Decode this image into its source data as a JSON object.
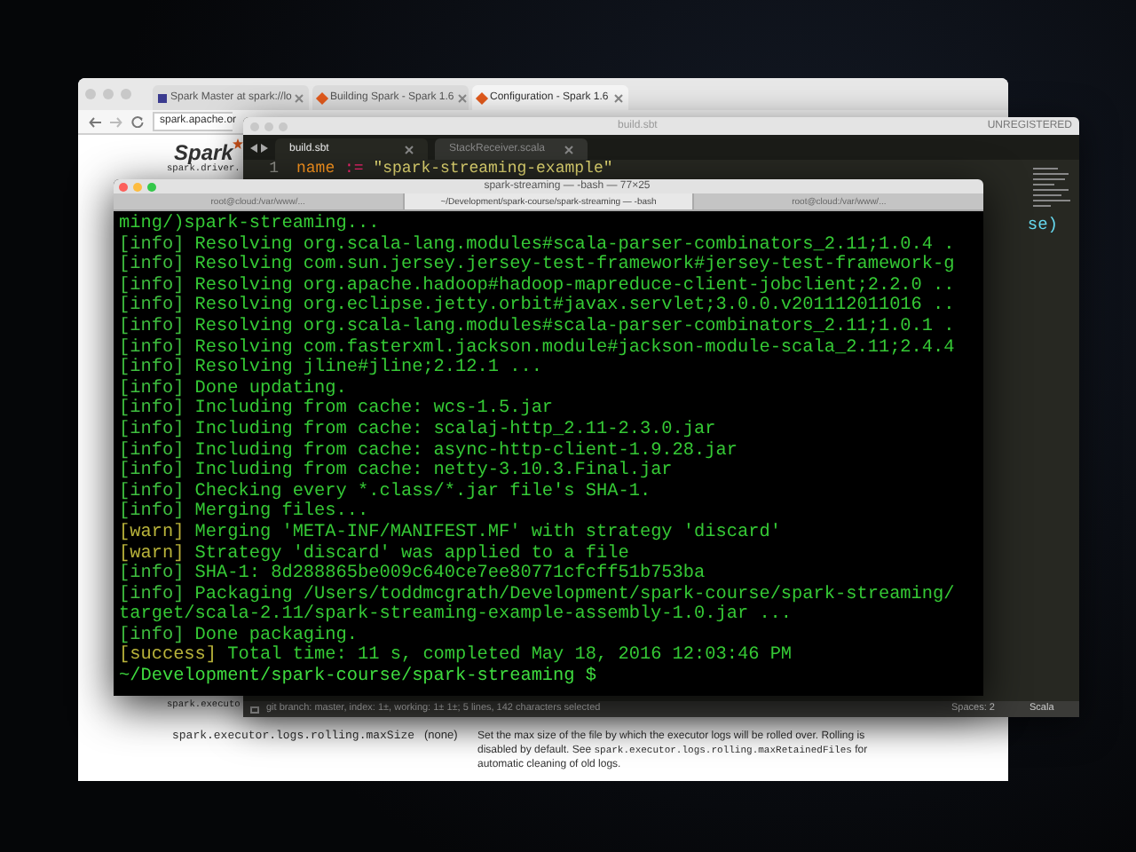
{
  "browser": {
    "tabs": [
      {
        "label": "Spark Master at spark://lo",
        "selected": false
      },
      {
        "label": "Building Spark - Spark 1.6",
        "selected": false
      },
      {
        "label": "Configuration - Spark 1.6",
        "selected": true
      }
    ],
    "url": "spark.apache.or",
    "logo_text": "Spark",
    "peek_texts": [
      "spark.driver.",
      "spark.executo"
    ],
    "config_row": {
      "name": "spark.executor.logs.rolling.maxSize",
      "default": "(none)",
      "description": [
        {
          "text": "Set the max size of the file by which the executor logs will be rolled over. Rolling is disabled by default. See ",
          "kind": "prose"
        },
        {
          "text": "spark.executor.logs.rolling.maxRetainedFiles",
          "kind": "code"
        },
        {
          "text": " for automatic cleaning of old logs.",
          "kind": "prose"
        }
      ]
    }
  },
  "editor": {
    "title": "build.sbt",
    "license": "UNREGISTERED",
    "tabs": [
      {
        "label": "build.sbt",
        "selected": true
      },
      {
        "label": "StackReceiver.scala",
        "selected": false
      }
    ],
    "lines": [
      {
        "number": "1",
        "tokens": [
          {
            "text": "name",
            "kind": "key"
          },
          {
            "text": " := ",
            "kind": "op"
          },
          {
            "text": "\"spark-streaming-example\"",
            "kind": "string"
          }
        ]
      }
    ],
    "code_fragment": "se)",
    "status_bar": {
      "left": "git branch: master, index: 1±, working: 1± 1±; 5 lines, 142 characters selected",
      "spaces": "Spaces: 2",
      "syntax": "Scala"
    }
  },
  "terminal": {
    "title": "spark-streaming — -bash — 77×25",
    "tabs": [
      {
        "label": "root@cloud:/var/www/...",
        "selected": false
      },
      {
        "label": "~/Development/spark-course/spark-streaming — -bash",
        "selected": true
      },
      {
        "label": "root@cloud:/var/www/...",
        "selected": false
      }
    ],
    "lines": [
      {
        "kind": "plain",
        "text": "ming/)spark-streaming..."
      },
      {
        "kind": "info",
        "tag": "[info]",
        "text": " Resolving org.scala-lang.modules#scala-parser-combinators_2.11;1.0.4 ."
      },
      {
        "kind": "info",
        "tag": "[info]",
        "text": " Resolving com.sun.jersey.jersey-test-framework#jersey-test-framework-g"
      },
      {
        "kind": "info",
        "tag": "[info]",
        "text": " Resolving org.apache.hadoop#hadoop-mapreduce-client-jobclient;2.2.0 .."
      },
      {
        "kind": "info",
        "tag": "[info]",
        "text": " Resolving org.eclipse.jetty.orbit#javax.servlet;3.0.0.v201112011016 .."
      },
      {
        "kind": "info",
        "tag": "[info]",
        "text": " Resolving org.scala-lang.modules#scala-parser-combinators_2.11;1.0.1 ."
      },
      {
        "kind": "info",
        "tag": "[info]",
        "text": " Resolving com.fasterxml.jackson.module#jackson-module-scala_2.11;2.4.4"
      },
      {
        "kind": "info",
        "tag": "[info]",
        "text": " Resolving jline#jline;2.12.1 ..."
      },
      {
        "kind": "info",
        "tag": "[info]",
        "text": " Done updating."
      },
      {
        "kind": "info",
        "tag": "[info]",
        "text": " Including from cache: wcs-1.5.jar"
      },
      {
        "kind": "info",
        "tag": "[info]",
        "text": " Including from cache: scalaj-http_2.11-2.3.0.jar"
      },
      {
        "kind": "info",
        "tag": "[info]",
        "text": " Including from cache: async-http-client-1.9.28.jar"
      },
      {
        "kind": "info",
        "tag": "[info]",
        "text": " Including from cache: netty-3.10.3.Final.jar"
      },
      {
        "kind": "info",
        "tag": "[info]",
        "text": " Checking every *.class/*.jar file's SHA-1."
      },
      {
        "kind": "info",
        "tag": "[info]",
        "text": " Merging files..."
      },
      {
        "kind": "warn",
        "tag": "[warn]",
        "text": " Merging 'META-INF/MANIFEST.MF' with strategy 'discard'"
      },
      {
        "kind": "warn",
        "tag": "[warn]",
        "text": " Strategy 'discard' was applied to a file"
      },
      {
        "kind": "info",
        "tag": "[info]",
        "text": " SHA-1: 8d288865be009c640ce7ee80771cfcff51b753ba"
      },
      {
        "kind": "info",
        "tag": "[info]",
        "text": " Packaging /Users/toddmcgrath/Development/spark-course/spark-streaming/"
      },
      {
        "kind": "plain",
        "text": "target/scala-2.11/spark-streaming-example-assembly-1.0.jar ..."
      },
      {
        "kind": "info",
        "tag": "[info]",
        "text": " Done packaging."
      },
      {
        "kind": "success",
        "tag": "[success]",
        "text": " Total time: 11 s, completed May 18, 2016 12:03:46 PM"
      },
      {
        "kind": "prompt",
        "text": "~/Development/spark-course/spark-streaming $"
      }
    ]
  }
}
